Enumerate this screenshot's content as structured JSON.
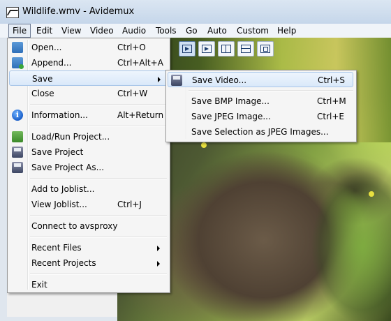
{
  "window": {
    "title": "Wildlife.wmv - Avidemux"
  },
  "menubar": {
    "items": [
      {
        "label": "File"
      },
      {
        "label": "Edit"
      },
      {
        "label": "View"
      },
      {
        "label": "Video"
      },
      {
        "label": "Audio"
      },
      {
        "label": "Tools"
      },
      {
        "label": "Go"
      },
      {
        "label": "Auto"
      },
      {
        "label": "Custom"
      },
      {
        "label": "Help"
      }
    ]
  },
  "file_menu": {
    "items": [
      {
        "label": "Open...",
        "shortcut": "Ctrl+O",
        "icon": "open-folder-icon"
      },
      {
        "label": "Append...",
        "shortcut": "Ctrl+Alt+A",
        "icon": "append-icon"
      },
      {
        "label": "Save",
        "shortcut": "",
        "submenu": true
      },
      {
        "label": "Close",
        "shortcut": "Ctrl+W"
      },
      {
        "label": "Information...",
        "shortcut": "Alt+Return",
        "icon": "info-icon"
      },
      {
        "label": "Load/Run Project...",
        "shortcut": "",
        "icon": "load-project-icon"
      },
      {
        "label": "Save Project",
        "shortcut": "",
        "icon": "save-project-icon"
      },
      {
        "label": "Save Project As...",
        "shortcut": "",
        "icon": "save-project-as-icon"
      },
      {
        "label": "Add to Joblist...",
        "shortcut": ""
      },
      {
        "label": "View Joblist...",
        "shortcut": "Ctrl+J"
      },
      {
        "label": "Connect to avsproxy",
        "shortcut": ""
      },
      {
        "label": "Recent Files",
        "shortcut": "",
        "submenu": true
      },
      {
        "label": "Recent Projects",
        "shortcut": "",
        "submenu": true
      },
      {
        "label": "Exit",
        "shortcut": ""
      }
    ]
  },
  "save_menu": {
    "items": [
      {
        "label": "Save Video...",
        "shortcut": "Ctrl+S",
        "icon": "save-video-icon"
      },
      {
        "label": "Save BMP Image...",
        "shortcut": "Ctrl+M"
      },
      {
        "label": "Save JPEG Image...",
        "shortcut": "Ctrl+E"
      },
      {
        "label": "Save Selection as JPEG Images...",
        "shortcut": ""
      }
    ]
  }
}
